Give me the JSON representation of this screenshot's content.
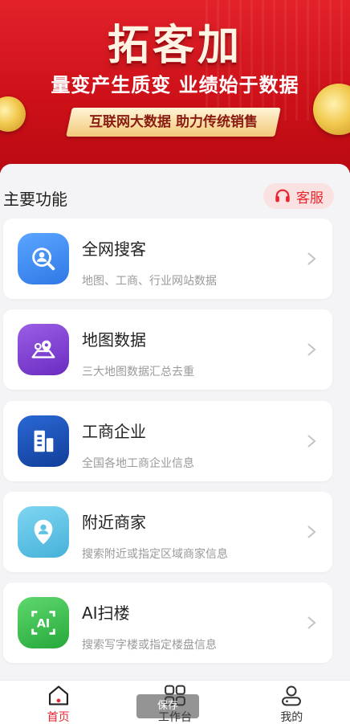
{
  "banner": {
    "title": "拓客加",
    "subtitle": "量变产生质变 业绩始于数据",
    "ribbon": "互联网大数据 助力传统销售"
  },
  "main": {
    "section_title": "主要功能",
    "service_label": "客服",
    "cards": [
      {
        "title": "全网搜客",
        "desc": "地图、工商、行业网站数据",
        "icon": "search-person-icon",
        "color": "#3d8ef2"
      },
      {
        "title": "地图数据",
        "desc": "三大地图数据汇总去重",
        "icon": "map-pin-icon",
        "color": "#7e3fd0"
      },
      {
        "title": "工商企业",
        "desc": "全国各地工商企业信息",
        "icon": "building-icon",
        "color": "#1c4fb5"
      },
      {
        "title": "附近商家",
        "desc": "搜索附近或指定区域商家信息",
        "icon": "location-person-icon",
        "color": "#5cc3e4"
      },
      {
        "title": "AI扫楼",
        "desc": "搜索写字楼或指定楼盘信息",
        "icon": "ai-scan-icon",
        "color": "#3bbf4f"
      }
    ]
  },
  "nav": {
    "items": [
      {
        "label": "首页",
        "icon": "home-icon",
        "active": true
      },
      {
        "label": "工作台",
        "icon": "grid-icon",
        "active": false
      },
      {
        "label": "我的",
        "icon": "user-icon",
        "active": false
      }
    ],
    "toast": "保存"
  },
  "colors": {
    "accent": "#e8252f",
    "banner": "#d3141c"
  }
}
